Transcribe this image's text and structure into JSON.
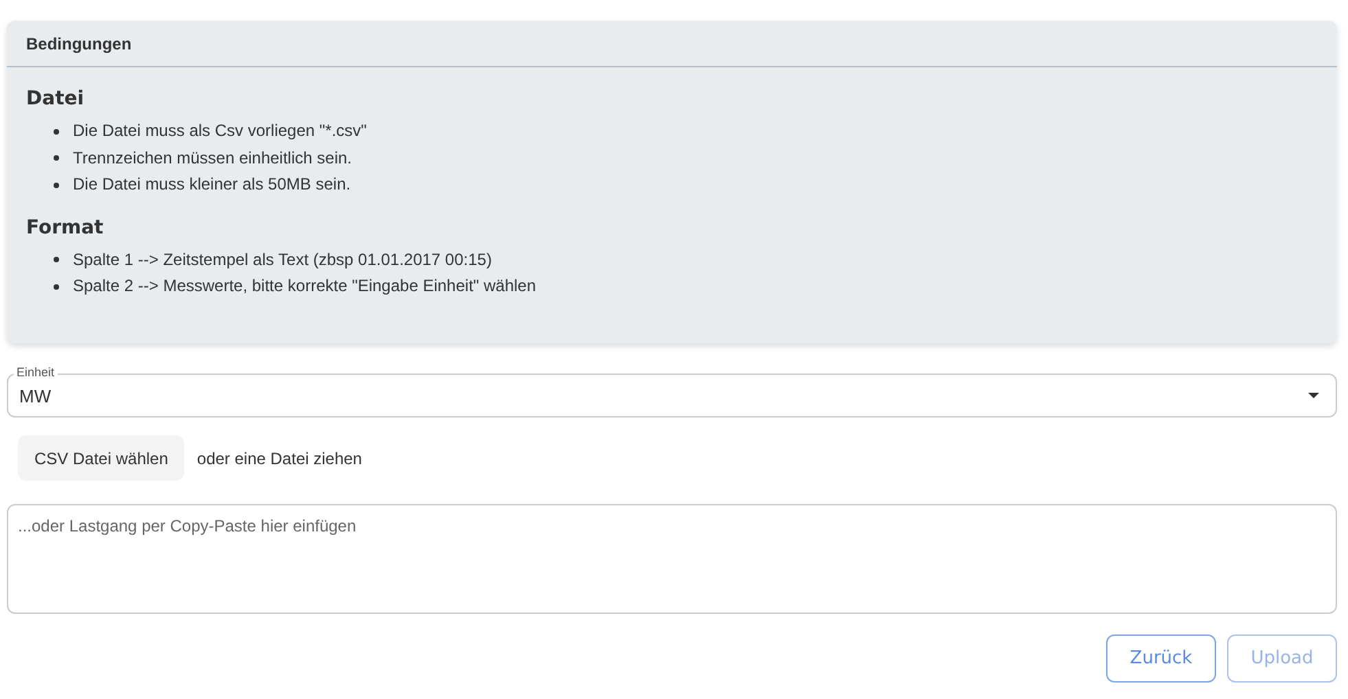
{
  "card": {
    "title": "Bedingungen",
    "sections": [
      {
        "heading": "Datei",
        "items": [
          "Die Datei muss als Csv vorliegen \"*.csv\"",
          "Trennzeichen müssen einheitlich sein.",
          "Die Datei muss kleiner als 50MB sein."
        ]
      },
      {
        "heading": "Format",
        "items": [
          "Spalte 1 --> Zeitstempel als Text (zbsp 01.01.2017 00:15)",
          "Spalte 2 --> Messwerte, bitte korrekte \"Eingabe Einheit\" wählen"
        ]
      }
    ]
  },
  "unit_select": {
    "label": "Einheit",
    "value": "MW"
  },
  "file_button": "CSV Datei wählen",
  "file_hint": "oder eine Datei ziehen",
  "paste_field": {
    "placeholder": "...oder Lastgang per Copy-Paste hier einfügen"
  },
  "buttons": [
    {
      "label": "Zurück",
      "disabled": false
    },
    {
      "label": "Upload",
      "disabled": true
    }
  ]
}
